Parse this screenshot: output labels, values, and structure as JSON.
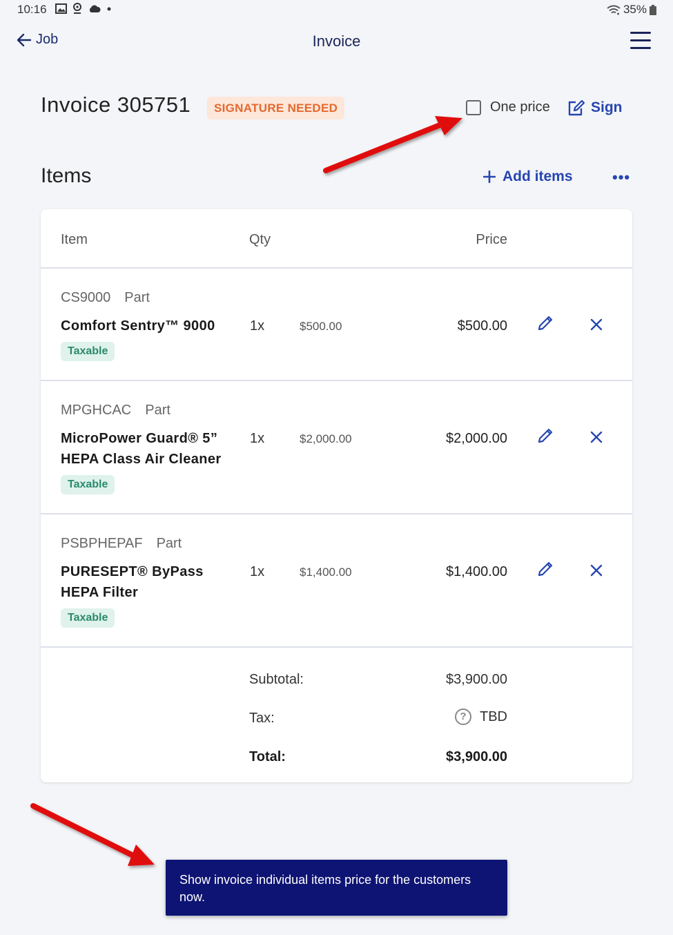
{
  "status_bar": {
    "time": "10:16",
    "battery": "35%"
  },
  "appbar": {
    "back_label": "Job",
    "title": "Invoice"
  },
  "invoice": {
    "title": "Invoice 305751",
    "badge": "SIGNATURE NEEDED",
    "one_price_label": "One price",
    "sign_label": "Sign"
  },
  "items_section": {
    "title": "Items",
    "add_label": "Add items",
    "more_label": "•••"
  },
  "table": {
    "headers": {
      "item": "Item",
      "qty": "Qty",
      "price": "Price"
    },
    "rows": [
      {
        "code": "CS9000",
        "type": "Part",
        "name": "Comfort Sentry™ 9000",
        "taxable": "Taxable",
        "qty": "1x",
        "unit_price": "$500.00",
        "price": "$500.00"
      },
      {
        "code": "MPGHCAC",
        "type": "Part",
        "name": "MicroPower Guard® 5” HEPA Class Air Cleaner",
        "taxable": "Taxable",
        "qty": "1x",
        "unit_price": "$2,000.00",
        "price": "$2,000.00"
      },
      {
        "code": "PSBPHEPAF",
        "type": "Part",
        "name": "PURESEPT® ByPass HEPA Filter",
        "taxable": "Taxable",
        "qty": "1x",
        "unit_price": "$1,400.00",
        "price": "$1,400.00"
      }
    ]
  },
  "totals": {
    "subtotal_label": "Subtotal:",
    "subtotal": "$3,900.00",
    "tax_label": "Tax:",
    "tax": "TBD",
    "total_label": "Total:",
    "total": "$3,900.00"
  },
  "toast": {
    "message": "Show invoice individual items price for the customers now."
  },
  "colors": {
    "accent": "#2646b0",
    "toast_bg": "#0e1473",
    "badge_text": "#e3692e",
    "annotation_arrow": "#e01010"
  }
}
